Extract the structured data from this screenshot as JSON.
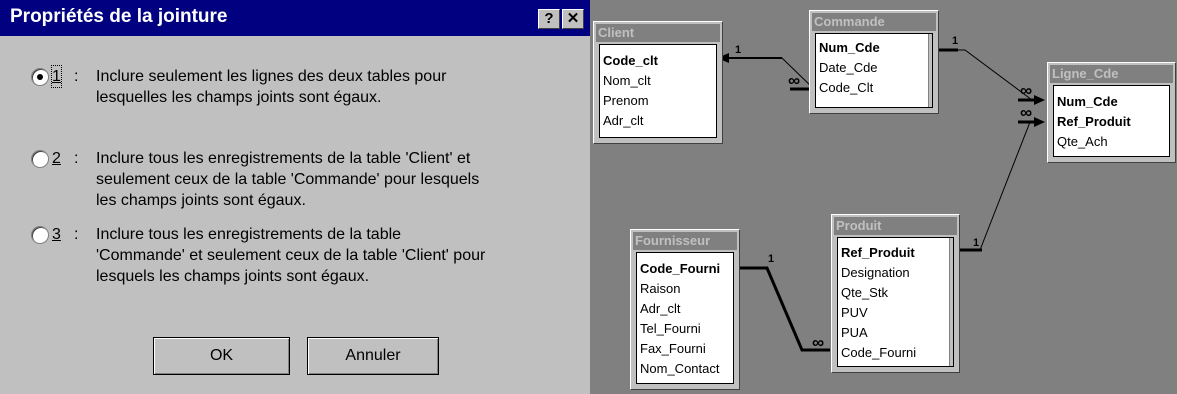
{
  "dialog": {
    "title": "Propriétés de la jointure",
    "help_button": "?",
    "close_button": "✕",
    "options": [
      {
        "number": "1",
        "separator": ":",
        "selected": true,
        "text": "Inclure seulement les lignes des deux tables pour\nlesquelles les champs joints sont égaux."
      },
      {
        "number": "2",
        "separator": ":",
        "selected": false,
        "text": "Inclure tous les enregistrements de la table 'Client' et\nseulement ceux de la table  'Commande' pour lesquels\nles champs joints sont égaux."
      },
      {
        "number": "3",
        "separator": ":",
        "selected": false,
        "text": "Inclure tous les enregistrements de la table\n'Commande' et seulement ceux de la table  'Client' pour\nlesquels les champs joints sont égaux."
      }
    ],
    "ok_label": "OK",
    "cancel_label": "Annuler"
  },
  "diagram": {
    "tables": [
      {
        "name": "Client",
        "fields": [
          {
            "label": "Code_clt",
            "key": true
          },
          {
            "label": "Nom_clt",
            "key": false
          },
          {
            "label": "Prenom",
            "key": false
          },
          {
            "label": "Adr_clt",
            "key": false
          }
        ]
      },
      {
        "name": "Commande",
        "fields": [
          {
            "label": "Num_Cde",
            "key": true
          },
          {
            "label": "Date_Cde",
            "key": false
          },
          {
            "label": "Code_Clt",
            "key": false
          }
        ]
      },
      {
        "name": "Ligne_Cde",
        "fields": [
          {
            "label": "Num_Cde",
            "key": true
          },
          {
            "label": "Ref_Produit",
            "key": true
          },
          {
            "label": "Qte_Ach",
            "key": false
          }
        ]
      },
      {
        "name": "Fournisseur",
        "fields": [
          {
            "label": "Code_Fourni",
            "key": true
          },
          {
            "label": "Raison",
            "key": false
          },
          {
            "label": "Adr_clt",
            "key": false
          },
          {
            "label": "Tel_Fourni",
            "key": false
          },
          {
            "label": "Fax_Fourni",
            "key": false
          },
          {
            "label": "Nom_Contact",
            "key": false
          }
        ]
      },
      {
        "name": "Produit",
        "fields": [
          {
            "label": "Ref_Produit",
            "key": true
          },
          {
            "label": "Designation",
            "key": false
          },
          {
            "label": "Qte_Stk",
            "key": false
          },
          {
            "label": "PUV",
            "key": false
          },
          {
            "label": "PUA",
            "key": false
          },
          {
            "label": "Code_Fourni",
            "key": false
          }
        ]
      }
    ],
    "relation_labels": {
      "one": "1",
      "many": "∞"
    }
  }
}
